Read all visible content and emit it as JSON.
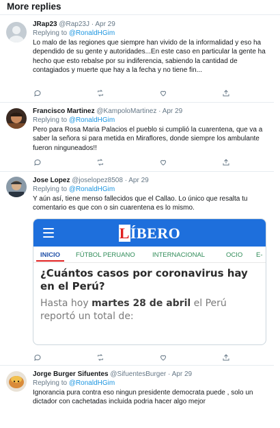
{
  "section_title": "More replies",
  "colors": {
    "link": "#1b95e0",
    "muted": "#657786",
    "border": "#e6ecf0",
    "libero_blue": "#1e6fdc",
    "libero_red": "#e02020"
  },
  "tweets": [
    {
      "display_name": "JRap23",
      "handle": "@Rap23J",
      "dot": "·",
      "time": "Apr 29",
      "replying_prefix": "Replying to",
      "replying_to": "@RonaldHGim",
      "text": "Lo malo de las regiones que siempre han vivido de la informalidad y eso ha dependido de su gente y autoridades...En este caso en particular la gente ha hecho que esto rebalse por su indiferencia, sabiendo la cantidad de contagiados y muerte que hay a la fecha y no tiene fin..."
    },
    {
      "display_name": "Francisco Martinez",
      "handle": "@KampoloMartinez",
      "dot": "·",
      "time": "Apr 29",
      "replying_prefix": "Replying to",
      "replying_to": "@RonaldHGim",
      "text": "Pero para Rosa Maria Palacios el pueblo si cumplió la cuarentena, que va a saber la señora si para metida en Miraflores, donde siempre los ambulante fueron ninguneados!!"
    },
    {
      "display_name": "Jose Lopez",
      "handle": "@joselopez8508",
      "dot": "·",
      "time": "Apr 29",
      "replying_prefix": "Replying to",
      "replying_to": "@RonaldHGim",
      "text": "Y aún así, tiene menso fallecidos que el Callao. Lo único que resalta tu comentario es que con o sin cuarentena es lo mismo.",
      "card": {
        "logo_first": "L",
        "logo_rest": "ÍBERO",
        "tabs": [
          "INICIO",
          "FÚTBOL PERUANO",
          "INTERNACIONAL",
          "OCIO",
          "E-"
        ],
        "headline": "¿Cuántos casos por coronavirus hay en el Perú?",
        "lead_before": "Hasta hoy",
        "lead_bold": "martes 28 de abril",
        "lead_after": "el Perú reportó un total de:"
      }
    },
    {
      "display_name": "Jorge Burger Sifuentes",
      "handle": "@SifuentesBurger",
      "dot": "·",
      "time": "Apr 29",
      "replying_prefix": "Replying to",
      "replying_to": "@RonaldHGim",
      "text": "Ignorancia pura contra eso ningun presidente democrata puede , solo un dictador con cachetadas incluida podria hacer algo mejor"
    }
  ]
}
